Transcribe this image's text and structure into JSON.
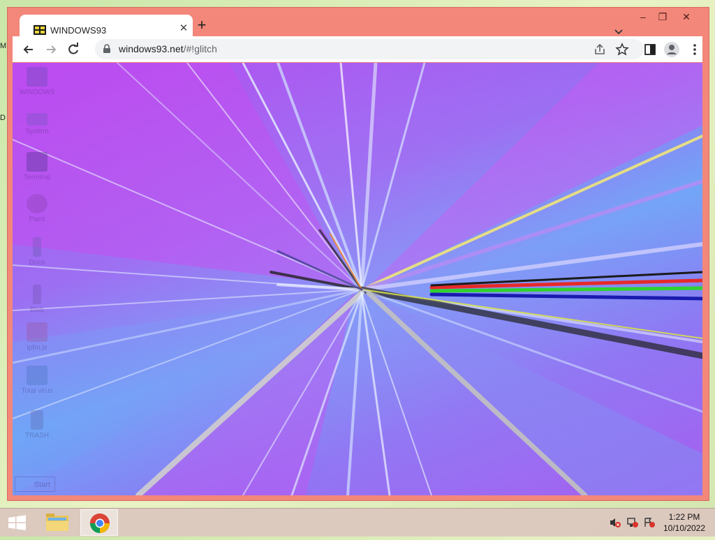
{
  "window": {
    "tab_title": "WINDOWS93",
    "tab_close_icon": "close-icon",
    "new_tab_icon": "plus-icon",
    "controls": {
      "minimize": "minimize-icon",
      "maximize": "maximize-icon",
      "close": "close-icon"
    }
  },
  "toolbar": {
    "url_host": "windows93.net",
    "url_path": "/#!glitch",
    "icons": [
      "back-icon",
      "forward-icon",
      "reload-icon",
      "lock-icon",
      "share-icon",
      "star-icon",
      "side-panel-icon",
      "profile-icon",
      "menu-icon"
    ]
  },
  "desktop": {
    "items": [
      {
        "label": "WINDOWS",
        "icon": "computer-icon",
        "color": "#4a4aa0"
      },
      {
        "label": "System",
        "icon": "drive-icon",
        "color": "#5a5ab0"
      },
      {
        "label": "Terminal",
        "icon": "terminal-icon",
        "color": "#2a2a6a"
      },
      {
        "label": "Paint",
        "icon": "palette-icon",
        "color": "#7a3a9a"
      },
      {
        "label": "Docs",
        "icon": "wrench-icon",
        "color": "#5a5aa0"
      },
      {
        "label": "Blob",
        "icon": "figure-icon",
        "color": "#6a4aa0"
      },
      {
        "label": "ipfm.js",
        "icon": "app-icon",
        "color": "#a04a8a"
      },
      {
        "label": "Total virus",
        "icon": "virus-icon",
        "color": "#3a6ab0"
      },
      {
        "label": "TRASH",
        "icon": "trash-icon",
        "color": "#5a5aa0"
      }
    ],
    "start_label": "Start"
  },
  "edge_letters": [
    "M",
    "D"
  ],
  "taskbar": {
    "start_icon": "windows-logo-icon",
    "apps": [
      {
        "name": "file-explorer",
        "icon": "folder-icon"
      },
      {
        "name": "chrome",
        "icon": "chrome-icon",
        "active": true
      }
    ],
    "tray_icons": [
      "volume-muted-icon",
      "network-icon",
      "action-center-icon"
    ],
    "time": "1:22 PM",
    "date": "10/10/2022"
  },
  "colors": {
    "frame": "#f2877a",
    "accent_purple": "#b64bf0",
    "accent_blue": "#6fa7f7"
  }
}
